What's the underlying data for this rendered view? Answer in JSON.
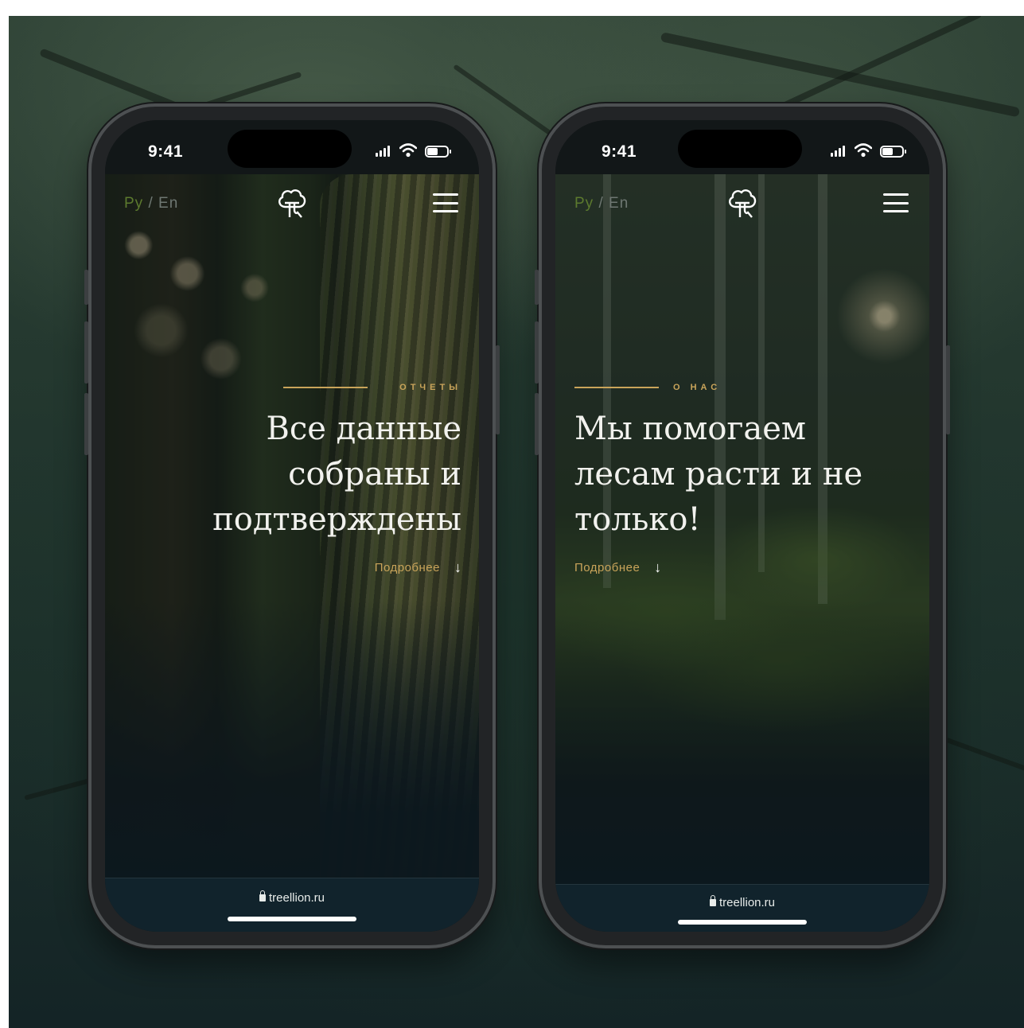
{
  "phones": [
    {
      "status": {
        "time": "9:41"
      },
      "nav": {
        "lang_ru": "Ру",
        "lang_sep": " / ",
        "lang_en": "En"
      },
      "hero": {
        "eyebrow": "ОТЧЕТЫ",
        "headline": "Все данные\nсобраны и\nподтверждены",
        "more_label": "Подробнее",
        "arrow": "↓"
      },
      "browser": {
        "url": "treellion.ru"
      }
    },
    {
      "status": {
        "time": "9:41"
      },
      "nav": {
        "lang_ru": "Ру",
        "lang_sep": " / ",
        "lang_en": "En"
      },
      "hero": {
        "eyebrow": "О НАС",
        "headline": "Мы помогаем\nлесам расти и не\nтолько!",
        "more_label": "Подробнее",
        "arrow": "↓"
      },
      "browser": {
        "url": "treellion.ru"
      }
    }
  ],
  "icons": {
    "logo": "tree-logo-icon",
    "menu": "hamburger-menu-icon",
    "signal": "cellular-signal-icon",
    "wifi": "wifi-icon",
    "battery": "battery-icon",
    "lock": "lock-icon"
  },
  "colors": {
    "accent_gold": "#c9a45a",
    "lang_active": "#5c7a2e",
    "lang_inactive": "#6e7772",
    "url_bar": "#11232c",
    "text_light": "#f2f2ee"
  }
}
